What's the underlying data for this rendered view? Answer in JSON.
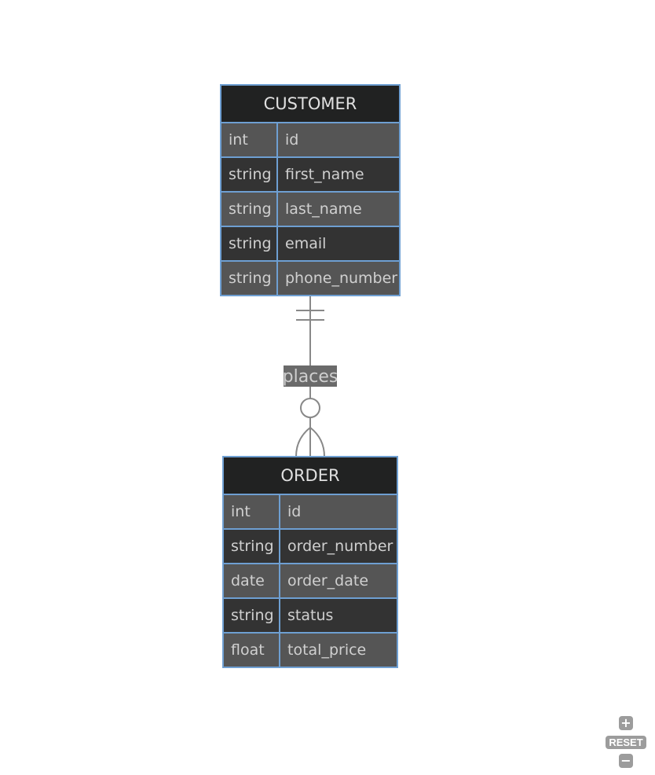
{
  "entities": [
    {
      "name": "CUSTOMER",
      "attributes": [
        {
          "type": "int",
          "name": "id"
        },
        {
          "type": "string",
          "name": "first_name"
        },
        {
          "type": "string",
          "name": "last_name"
        },
        {
          "type": "string",
          "name": "email"
        },
        {
          "type": "string",
          "name": "phone_number"
        }
      ]
    },
    {
      "name": "ORDER",
      "attributes": [
        {
          "type": "int",
          "name": "id"
        },
        {
          "type": "string",
          "name": "order_number"
        },
        {
          "type": "date",
          "name": "order_date"
        },
        {
          "type": "string",
          "name": "status"
        },
        {
          "type": "float",
          "name": "total_price"
        }
      ]
    }
  ],
  "relationship": {
    "label": "places",
    "from": "CUSTOMER",
    "to": "ORDER",
    "from_cardinality": "exactly-one",
    "to_cardinality": "zero-or-more"
  },
  "colors": {
    "header_bg": "#212222",
    "row_light": "#555555",
    "row_dark": "#333333",
    "border": "#6e9fd2",
    "line": "#888888",
    "label_bg": "#6a6a6a"
  },
  "controls": {
    "zoom_in": "+",
    "reset": "RESET",
    "zoom_out": "−"
  }
}
